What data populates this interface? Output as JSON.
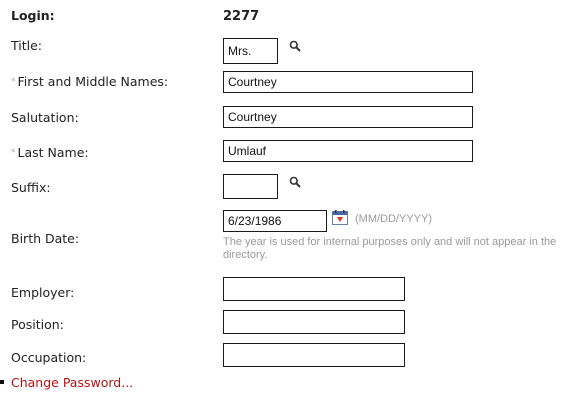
{
  "login": {
    "label": "Login:",
    "value": "2277"
  },
  "title": {
    "label": "Title:",
    "value": "Mrs."
  },
  "first_middle_names": {
    "required_mark": "*",
    "label": "First and Middle Names:",
    "value": "Courtney"
  },
  "salutation": {
    "label": "Salutation:",
    "value": "Courtney"
  },
  "last_name": {
    "required_mark": "*",
    "label": "Last Name:",
    "value": "Umlauf"
  },
  "suffix": {
    "label": "Suffix:",
    "value": ""
  },
  "birth_date": {
    "label": "Birth Date:",
    "value": "6/23/1986",
    "format_hint": "(MM/DD/YYYY)",
    "note": "The year is used for internal purposes only and will not appear in the directory."
  },
  "employer": {
    "label": "Employer:",
    "value": ""
  },
  "position": {
    "label": "Position:",
    "value": ""
  },
  "occupation": {
    "label": "Occupation:",
    "value": ""
  },
  "change_password": {
    "label": "Change Password..."
  },
  "icons": {
    "lookup": "search-icon",
    "calendar": "calendar-icon"
  },
  "colors": {
    "link": "#b01414",
    "hint": "#9a9a9a",
    "required_mark": "#b0b0b0"
  }
}
